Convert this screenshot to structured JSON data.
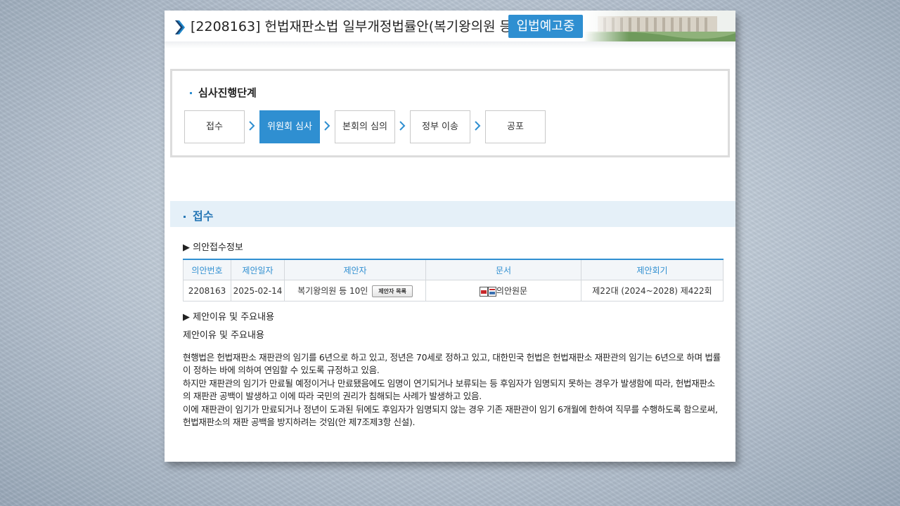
{
  "header": {
    "bill_title": "[2208163] 헌법재판소법 일부개정법률안(복기왕의원 등 10인)",
    "status_badge": "입법예고중"
  },
  "steps": {
    "title": "심사진행단계",
    "items": [
      {
        "label": "접수",
        "active": false
      },
      {
        "label": "위원회 심사",
        "active": true
      },
      {
        "label": "본회의 심의",
        "active": false
      },
      {
        "label": "정부 이송",
        "active": false
      },
      {
        "label": "공포",
        "active": false
      }
    ]
  },
  "section": {
    "title": "접수",
    "info_heading": "▶ 의안접수정보",
    "table": {
      "headers": [
        "의안번호",
        "제안일자",
        "제안자",
        "문서",
        "제안회기"
      ],
      "row": {
        "bill_no": "2208163",
        "date": "2025-02-14",
        "proposer": "복기왕의원 등 10인",
        "proposer_button": "제안자 목록",
        "document": "의안원문",
        "session": "제22대 (2024~2028) 제422회"
      }
    },
    "reason_heading": "▶ 제안이유 및 주요내용",
    "reason_label": "제안이유 및 주요내용",
    "body_lines": [
      "현행법은 헌법재판소 재판관의 임기를 6년으로 하고 있고, 정년은 70세로 정하고 있고, 대한민국 헌법은 헌법재판소 재판관의 임기는 6년으로 하며 법률",
      "이 정하는 바에 의하여 연임할 수 있도록 규정하고 있음.",
      "하지만 재판관의 임기가 만료될 예정이거나 만료됐음에도 임명이 연기되거나 보류되는 등 후임자가 임명되지 못하는 경우가 발생함에 따라, 헌법재판소",
      "의 재판관 공백이 발생하고 이에 따라 국민의 권리가 침해되는 사례가 발생하고 있음.",
      "이에 재판관이 임기가 만료되거나 정년이 도과된 뒤에도 후임자가 임명되지 않는 경우 기존 재판관이 임기 6개월에 한하여 직무를 수행하도록 함으로써,",
      "헌법재판소의 재판 공백을 방지하려는 것임(안 제7조제3항 신설)."
    ]
  },
  "colors": {
    "accent": "#2f8fd1",
    "section_bg": "#e5f0f8",
    "section_title": "#2878b6"
  }
}
